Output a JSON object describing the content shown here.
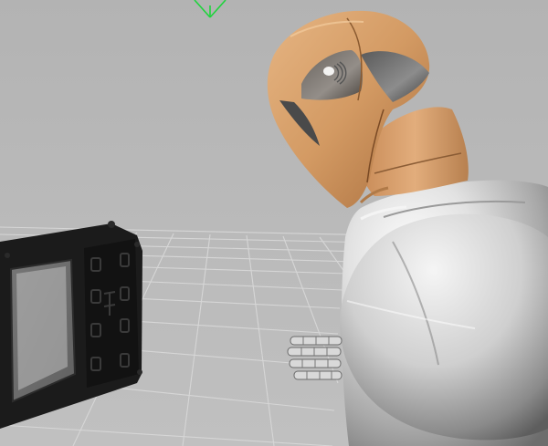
{
  "viewport": {
    "background_color": "#b9b9b9",
    "grid_color": "#d8d8d8"
  },
  "scene": {
    "objects": [
      {
        "name": "orientation-gizmo",
        "color": "#19d63a"
      },
      {
        "name": "robot-helmet",
        "color": "#d9a070"
      },
      {
        "name": "robot-neck",
        "color": "#d49a68"
      },
      {
        "name": "robot-torso",
        "color": "#d4d4d4"
      },
      {
        "name": "robot-hand",
        "color": "#c8c8c8"
      },
      {
        "name": "frame-panel",
        "color": "#1a1a1a"
      }
    ]
  }
}
